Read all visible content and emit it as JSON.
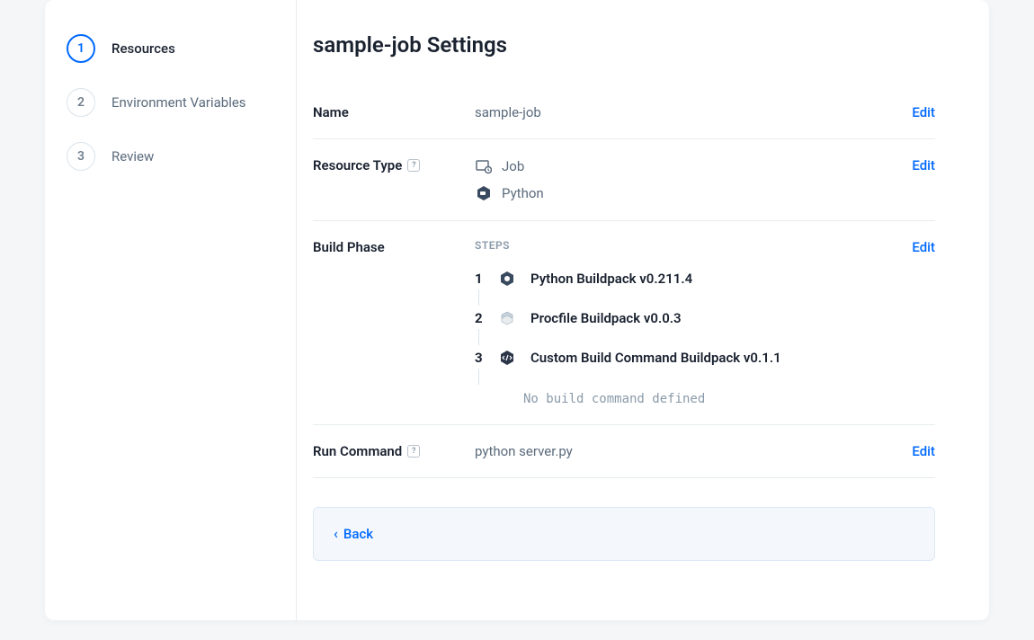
{
  "sidebar": {
    "steps": [
      {
        "num": "1",
        "label": "Resources",
        "active": true
      },
      {
        "num": "2",
        "label": "Environment Variables",
        "active": false
      },
      {
        "num": "3",
        "label": "Review",
        "active": false
      }
    ]
  },
  "page_title": "sample-job Settings",
  "name_section": {
    "label": "Name",
    "value": "sample-job",
    "edit": "Edit"
  },
  "resource_type_section": {
    "label": "Resource Type",
    "rows": [
      {
        "icon": "job-icon",
        "text": "Job"
      },
      {
        "icon": "python-icon",
        "text": "Python"
      }
    ],
    "edit": "Edit"
  },
  "build_phase_section": {
    "label": "Build Phase",
    "steps_header": "STEPS",
    "steps": [
      {
        "num": "1",
        "icon": "python-icon",
        "name": "Python Buildpack v0.211.4"
      },
      {
        "num": "2",
        "icon": "procfile-icon",
        "name": "Procfile Buildpack v0.0.3"
      },
      {
        "num": "3",
        "icon": "custom-icon",
        "name": "Custom Build Command Buildpack v0.1.1"
      }
    ],
    "no_command": "No build command defined",
    "edit": "Edit"
  },
  "run_command_section": {
    "label": "Run Command",
    "value": "python server.py",
    "edit": "Edit"
  },
  "footer": {
    "back": "Back"
  }
}
